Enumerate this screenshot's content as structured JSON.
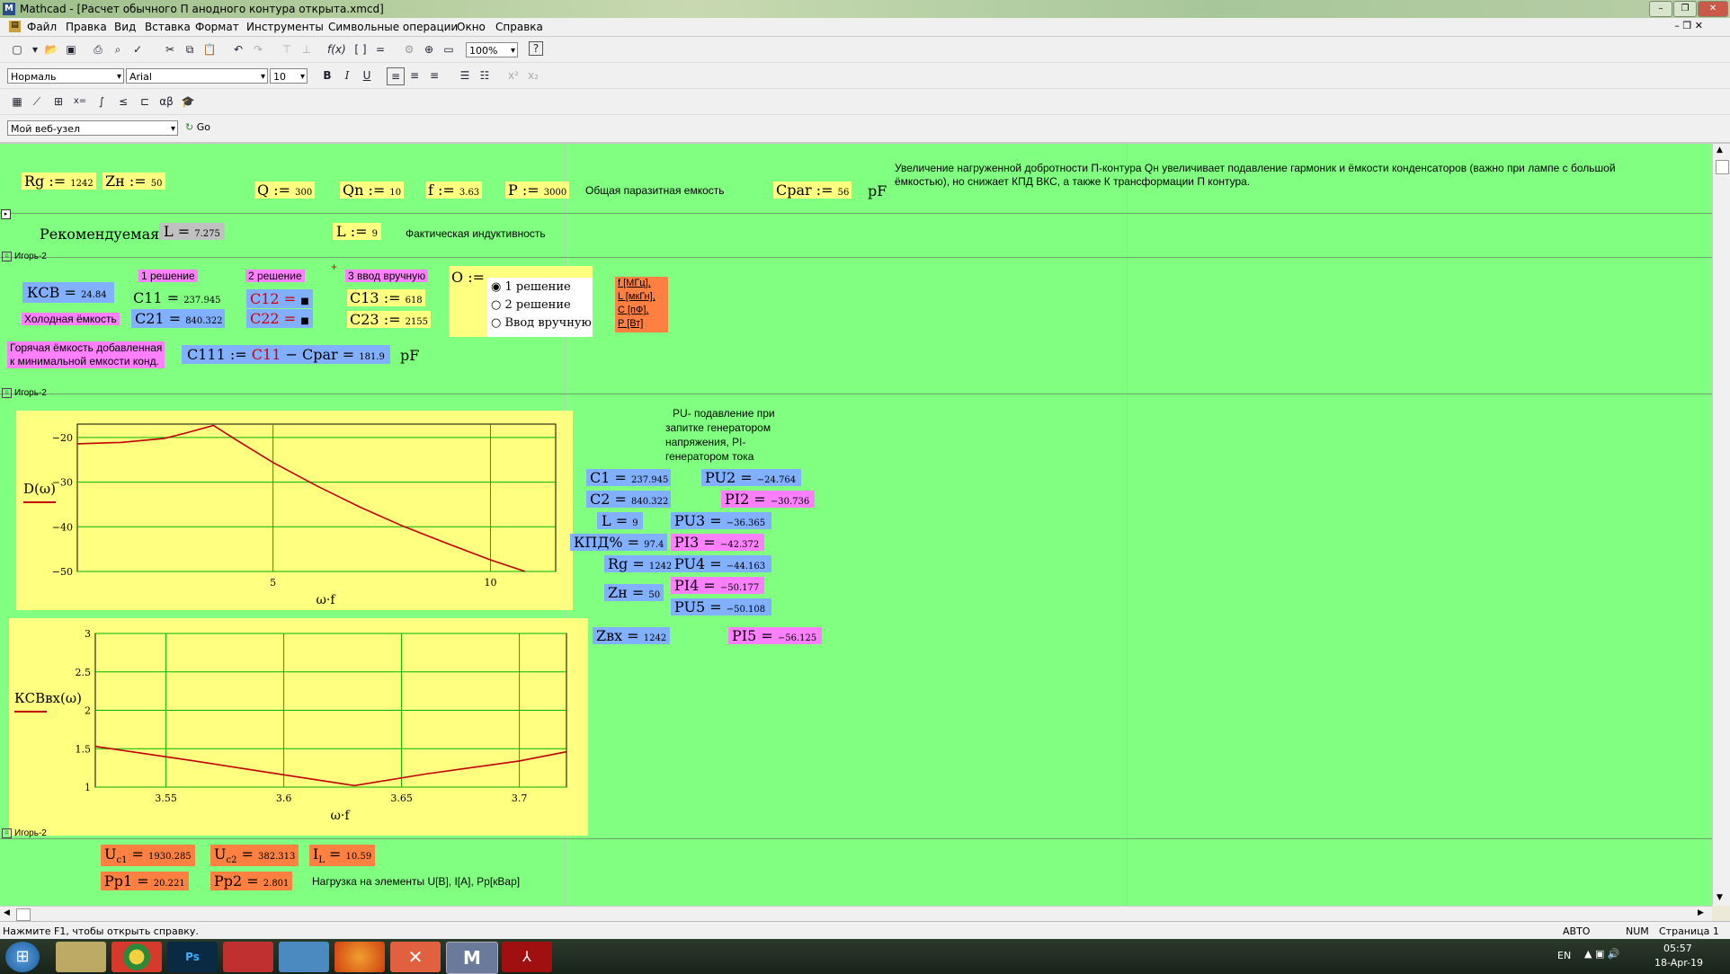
{
  "window": {
    "title": "Mathcad - [Расчет обычного П анодного контура открыта.xmcd]"
  },
  "menu": [
    "Файл",
    "Правка",
    "Вид",
    "Вставка",
    "Формат",
    "Инструменты",
    "Символьные операции",
    "Окно",
    "Справка"
  ],
  "toolbar": {
    "zoom": "100%",
    "style": "Нормаль",
    "font": "Arial",
    "font_size": "10",
    "web_node": "Мой веб-узел",
    "go": "Go"
  },
  "sheet": {
    "row1": {
      "rg_lbl": "Rg :=",
      "rg_val": "1242",
      "zn_lbl": "Zн :=",
      "zn_val": "50",
      "q_lbl": "Q :=",
      "q_val": "300",
      "qn_lbl": "Qn :=",
      "qn_val": "10",
      "f_lbl": "f :=",
      "f_val": "3.63",
      "p_lbl": "P :=",
      "p_val": "3000",
      "cpar_text": "Общая паразитная емкость",
      "cpar_lbl": "Cpar :=",
      "cpar_val": "56",
      "pf": "pF",
      "note": "Увеличение нагруженной добротности П-контура Qн увеличивает подавление гармоник и ёмкости конденсаторов (важно при лампе с большой ёмкостью), но снижает КПД ВКС, а также К трансформации П контура."
    },
    "row2": {
      "recommended": "Рекомендуемая",
      "l_rec_lbl": "L =",
      "l_rec_val": "7.275",
      "l_lbl": "L :=",
      "l_val": "9",
      "actual": "Фактическая индуктивность"
    },
    "area_label": "Игорь-2",
    "row3": {
      "sol1": "1 решение",
      "sol2": "2 решение",
      "sol3": "3 ввод вручную",
      "ksv_lbl": "КСВ =",
      "ksv_val": "24.84",
      "cold": "Холодная ёмкость",
      "c11_lbl": "C11 =",
      "c11_val": "237.945",
      "c21_lbl": "C21 =",
      "c21_val": "840.322",
      "c12_lbl": "C12 =",
      "c12_val": "■",
      "c22_lbl": "C22 =",
      "c22_val": "■",
      "c13_lbl": "C13 :=",
      "c13_val": "618",
      "c23_lbl": "C23 :=",
      "c23_val": "2155",
      "o_lbl": "O :=",
      "radio": [
        "1 решение",
        "2 решение",
        "Ввод вручную"
      ],
      "units": [
        "f [МГц],",
        "L [мкГн],",
        "C [пФ],",
        "P [Вт]"
      ],
      "hot1": "Горячая ёмкость добавленная",
      "hot2": "к минимальной емкости конд.",
      "c111_lbl": "C111 :=",
      "c111_c11": "C11",
      "c111_rest": "− Cpar =",
      "c111_val": "181.9",
      "pf": "pF"
    },
    "results": {
      "title": [
        "PU- подавление при",
        "запитке генератором",
        "напряжения, PI-",
        "генератором тока"
      ],
      "c1_lbl": "C1 =",
      "c1_val": "237.945",
      "c2_lbl": "C2 =",
      "c2_val": "840.322",
      "l_lbl": "L =",
      "l_val": "9",
      "kpd_lbl": "КПД% =",
      "kpd_val": "97.4",
      "rg_lbl": "Rg =",
      "rg_val": "1242",
      "zn_lbl": "Zн =",
      "zn_val": "50",
      "zvx_lbl": "Zвх =",
      "zvx_val": "1242",
      "pu2_lbl": "PU2 =",
      "pu2_val": "−24.764",
      "pi2_lbl": "PI2 =",
      "pi2_val": "−30.736",
      "pu3_lbl": "PU3 =",
      "pu3_val": "−36.365",
      "pi3_lbl": "PI3 =",
      "pi3_val": "−42.372",
      "pu4_lbl": "PU4 =",
      "pu4_val": "−44.163",
      "pi4_lbl": "PI4 =",
      "pi4_val": "−50.177",
      "pu5_lbl": "PU5 =",
      "pu5_val": "−50.108",
      "pi5_lbl": "PI5 =",
      "pi5_val": "−56.125"
    },
    "bottom": {
      "uc1_lbl": "U",
      "uc1_sub": "c1",
      "uc1_val": "1930.285",
      "uc2_lbl": "U",
      "uc2_sub": "c2",
      "uc2_val": "382.313",
      "il_lbl": "I",
      "il_sub": "L",
      "il_val": "10.59",
      "pp1_lbl": "Pp1 =",
      "pp1_val": "20.221",
      "pp2_lbl": "Pp2 =",
      "pp2_val": "2.801",
      "load": "Нагрузка на элементы U[В], I[А], Pp[кВар]"
    }
  },
  "chart_data": [
    {
      "type": "line",
      "ylabel": "D(ω)",
      "xlabel": "ω·f",
      "xlim": [
        0.5,
        11.5
      ],
      "ylim": [
        -50,
        -17
      ],
      "xticks": [
        "5",
        "10"
      ],
      "yticks": [
        "−20",
        "−30",
        "−40",
        "−50"
      ],
      "grid": true,
      "color": "#c00000",
      "x": [
        0.5,
        1.5,
        2.5,
        3.0,
        3.63,
        4.2,
        5,
        6,
        7,
        8,
        9,
        10,
        10.8
      ],
      "y": [
        -21.4,
        -21.1,
        -20.2,
        -19.0,
        -17.3,
        -20.8,
        -25.6,
        -30.8,
        -35.6,
        -39.9,
        -43.7,
        -47.4,
        -50
      ]
    },
    {
      "type": "line",
      "ylabel": "КСВвх(ω)",
      "xlabel": "ω·f",
      "xlim": [
        3.52,
        3.72
      ],
      "ylim": [
        1,
        3
      ],
      "xticks": [
        "3.55",
        "3.6",
        "3.65",
        "3.7"
      ],
      "yticks": [
        "1",
        "1.5",
        "2",
        "2.5",
        "3"
      ],
      "grid": true,
      "color": "#c00000",
      "x": [
        3.52,
        3.56,
        3.6,
        3.63,
        3.66,
        3.7,
        3.72
      ],
      "y": [
        1.53,
        1.35,
        1.16,
        1.02,
        1.17,
        1.34,
        1.46
      ]
    }
  ],
  "status": {
    "help": "Нажмите F1, чтобы открыть справку.",
    "mode": "АВТО",
    "num": "NUM",
    "page": "Страница 1"
  },
  "taskbar": {
    "lang": "EN",
    "time": "05:57",
    "date": "18-Apr-19"
  }
}
